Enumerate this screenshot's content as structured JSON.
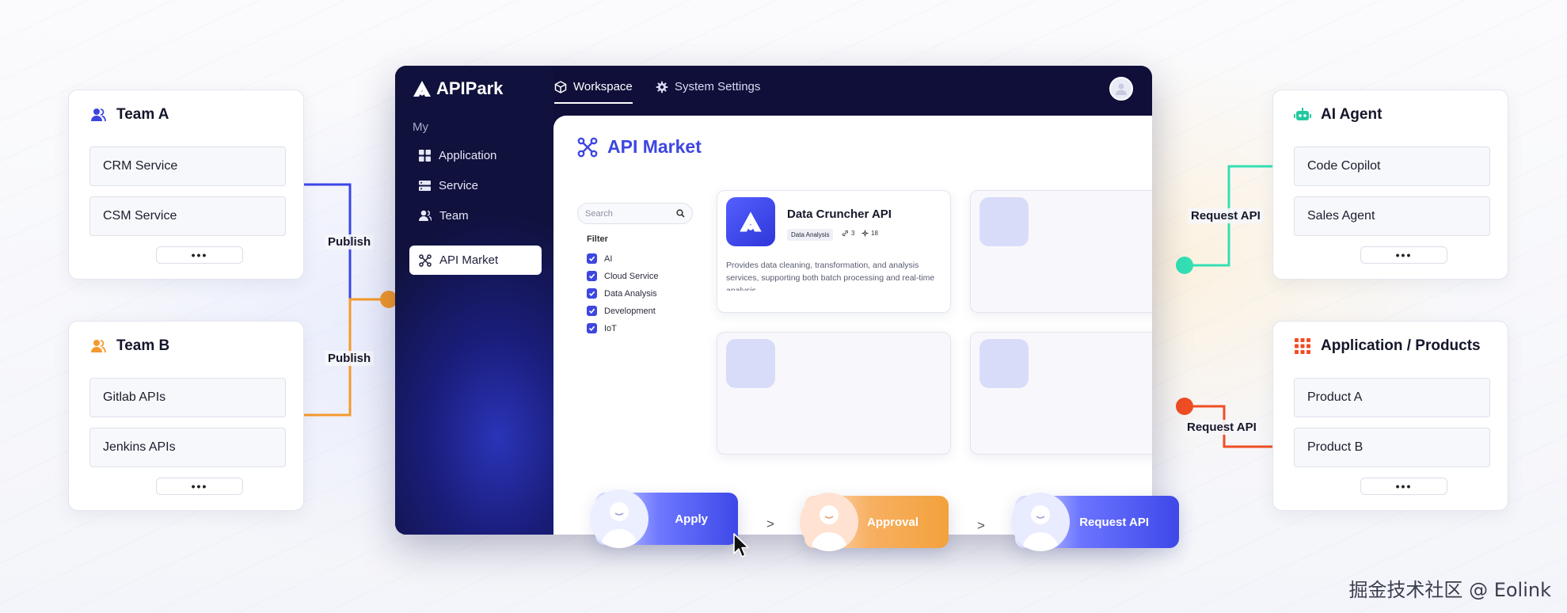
{
  "colors": {
    "brand": "#3d46e0",
    "publish_line_blue": "#3b46e8",
    "publish_line_orange": "#f49a2c",
    "request_line_green": "#34e0b4",
    "request_line_red": "#f04d24"
  },
  "team_a": {
    "icon": "user-icon",
    "title": "Team A",
    "items": [
      "CRM Service",
      "CSM Service"
    ],
    "more": "•••"
  },
  "team_b": {
    "icon": "user-icon",
    "title": "Team B",
    "items": [
      "Gitlab APIs",
      "Jenkins APIs"
    ],
    "more": "•••"
  },
  "ai_agent": {
    "icon": "robot-icon",
    "title": "AI Agent",
    "items": [
      "Code Copilot",
      "Sales Agent"
    ],
    "more": "•••"
  },
  "applications": {
    "icon": "grid-icon",
    "title": "Application / Products",
    "items": [
      "Product A",
      "Product B"
    ],
    "more": "•••"
  },
  "connectors": {
    "publish_a": "Publish",
    "publish_b": "Publish",
    "request_a": "Request API",
    "request_b": "Request API"
  },
  "app": {
    "logo": "APIPark",
    "tabs": [
      {
        "label": "Workspace",
        "icon": "cube-icon",
        "active": true
      },
      {
        "label": "System Settings",
        "icon": "gear-icon",
        "active": false
      }
    ],
    "nav_section": "My",
    "nav": [
      {
        "label": "Application",
        "icon": "grid-icon"
      },
      {
        "label": "Service",
        "icon": "server-icon"
      },
      {
        "label": "Team",
        "icon": "team-icon"
      },
      {
        "label": "API Market",
        "icon": "network-icon",
        "active": true
      }
    ],
    "market": {
      "title": "API Market",
      "search_placeholder": "Search",
      "filter_title": "Filter",
      "filters": [
        "AI",
        "Cloud Service",
        "Data Analysis",
        "Development",
        "IoT"
      ],
      "card": {
        "name": "Data Cruncher API",
        "tag": "Data Analysis",
        "links": "3",
        "calls": "18",
        "description": "Provides data cleaning, transformation, and analysis services, supporting both batch processing and real-time analysis."
      }
    }
  },
  "flow": {
    "steps": [
      "Apply",
      "Approval",
      "Request API"
    ],
    "separator": ">"
  },
  "watermark": "掘金技术社区 @ Eolink"
}
